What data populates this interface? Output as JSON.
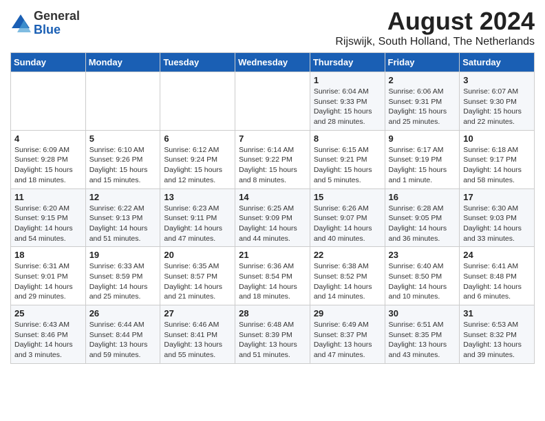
{
  "logo": {
    "general": "General",
    "blue": "Blue"
  },
  "title": "August 2024",
  "subtitle": "Rijswijk, South Holland, The Netherlands",
  "headers": [
    "Sunday",
    "Monday",
    "Tuesday",
    "Wednesday",
    "Thursday",
    "Friday",
    "Saturday"
  ],
  "weeks": [
    [
      {
        "day": "",
        "info": ""
      },
      {
        "day": "",
        "info": ""
      },
      {
        "day": "",
        "info": ""
      },
      {
        "day": "",
        "info": ""
      },
      {
        "day": "1",
        "info": "Sunrise: 6:04 AM\nSunset: 9:33 PM\nDaylight: 15 hours\nand 28 minutes."
      },
      {
        "day": "2",
        "info": "Sunrise: 6:06 AM\nSunset: 9:31 PM\nDaylight: 15 hours\nand 25 minutes."
      },
      {
        "day": "3",
        "info": "Sunrise: 6:07 AM\nSunset: 9:30 PM\nDaylight: 15 hours\nand 22 minutes."
      }
    ],
    [
      {
        "day": "4",
        "info": "Sunrise: 6:09 AM\nSunset: 9:28 PM\nDaylight: 15 hours\nand 18 minutes."
      },
      {
        "day": "5",
        "info": "Sunrise: 6:10 AM\nSunset: 9:26 PM\nDaylight: 15 hours\nand 15 minutes."
      },
      {
        "day": "6",
        "info": "Sunrise: 6:12 AM\nSunset: 9:24 PM\nDaylight: 15 hours\nand 12 minutes."
      },
      {
        "day": "7",
        "info": "Sunrise: 6:14 AM\nSunset: 9:22 PM\nDaylight: 15 hours\nand 8 minutes."
      },
      {
        "day": "8",
        "info": "Sunrise: 6:15 AM\nSunset: 9:21 PM\nDaylight: 15 hours\nand 5 minutes."
      },
      {
        "day": "9",
        "info": "Sunrise: 6:17 AM\nSunset: 9:19 PM\nDaylight: 15 hours\nand 1 minute."
      },
      {
        "day": "10",
        "info": "Sunrise: 6:18 AM\nSunset: 9:17 PM\nDaylight: 14 hours\nand 58 minutes."
      }
    ],
    [
      {
        "day": "11",
        "info": "Sunrise: 6:20 AM\nSunset: 9:15 PM\nDaylight: 14 hours\nand 54 minutes."
      },
      {
        "day": "12",
        "info": "Sunrise: 6:22 AM\nSunset: 9:13 PM\nDaylight: 14 hours\nand 51 minutes."
      },
      {
        "day": "13",
        "info": "Sunrise: 6:23 AM\nSunset: 9:11 PM\nDaylight: 14 hours\nand 47 minutes."
      },
      {
        "day": "14",
        "info": "Sunrise: 6:25 AM\nSunset: 9:09 PM\nDaylight: 14 hours\nand 44 minutes."
      },
      {
        "day": "15",
        "info": "Sunrise: 6:26 AM\nSunset: 9:07 PM\nDaylight: 14 hours\nand 40 minutes."
      },
      {
        "day": "16",
        "info": "Sunrise: 6:28 AM\nSunset: 9:05 PM\nDaylight: 14 hours\nand 36 minutes."
      },
      {
        "day": "17",
        "info": "Sunrise: 6:30 AM\nSunset: 9:03 PM\nDaylight: 14 hours\nand 33 minutes."
      }
    ],
    [
      {
        "day": "18",
        "info": "Sunrise: 6:31 AM\nSunset: 9:01 PM\nDaylight: 14 hours\nand 29 minutes."
      },
      {
        "day": "19",
        "info": "Sunrise: 6:33 AM\nSunset: 8:59 PM\nDaylight: 14 hours\nand 25 minutes."
      },
      {
        "day": "20",
        "info": "Sunrise: 6:35 AM\nSunset: 8:57 PM\nDaylight: 14 hours\nand 21 minutes."
      },
      {
        "day": "21",
        "info": "Sunrise: 6:36 AM\nSunset: 8:54 PM\nDaylight: 14 hours\nand 18 minutes."
      },
      {
        "day": "22",
        "info": "Sunrise: 6:38 AM\nSunset: 8:52 PM\nDaylight: 14 hours\nand 14 minutes."
      },
      {
        "day": "23",
        "info": "Sunrise: 6:40 AM\nSunset: 8:50 PM\nDaylight: 14 hours\nand 10 minutes."
      },
      {
        "day": "24",
        "info": "Sunrise: 6:41 AM\nSunset: 8:48 PM\nDaylight: 14 hours\nand 6 minutes."
      }
    ],
    [
      {
        "day": "25",
        "info": "Sunrise: 6:43 AM\nSunset: 8:46 PM\nDaylight: 14 hours\nand 3 minutes."
      },
      {
        "day": "26",
        "info": "Sunrise: 6:44 AM\nSunset: 8:44 PM\nDaylight: 13 hours\nand 59 minutes."
      },
      {
        "day": "27",
        "info": "Sunrise: 6:46 AM\nSunset: 8:41 PM\nDaylight: 13 hours\nand 55 minutes."
      },
      {
        "day": "28",
        "info": "Sunrise: 6:48 AM\nSunset: 8:39 PM\nDaylight: 13 hours\nand 51 minutes."
      },
      {
        "day": "29",
        "info": "Sunrise: 6:49 AM\nSunset: 8:37 PM\nDaylight: 13 hours\nand 47 minutes."
      },
      {
        "day": "30",
        "info": "Sunrise: 6:51 AM\nSunset: 8:35 PM\nDaylight: 13 hours\nand 43 minutes."
      },
      {
        "day": "31",
        "info": "Sunrise: 6:53 AM\nSunset: 8:32 PM\nDaylight: 13 hours\nand 39 minutes."
      }
    ]
  ]
}
